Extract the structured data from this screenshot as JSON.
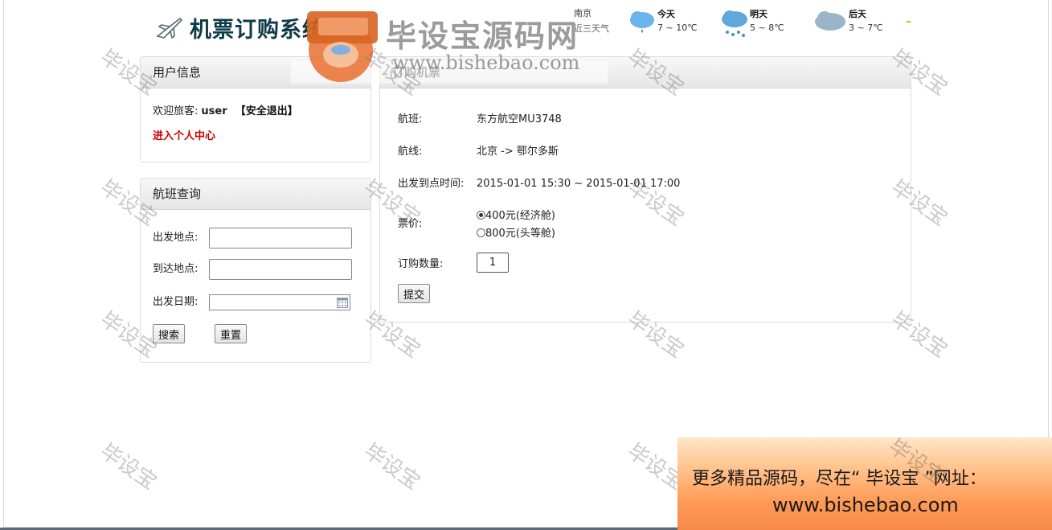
{
  "header": {
    "title": "机票订购系统",
    "plane_icon": "airplane-icon"
  },
  "weather": {
    "city": "南京",
    "subtitle": "近三天气",
    "days": [
      {
        "label": "今天",
        "temp": "7 ~ 10℃",
        "icon": "rain-cloud-icon"
      },
      {
        "label": "明天",
        "temp": "5 ~ 8℃",
        "icon": "heavy-rain-cloud-icon"
      },
      {
        "label": "后天",
        "temp": "3 ~ 7℃",
        "icon": "cloud-icon"
      }
    ]
  },
  "user_panel": {
    "title": "用户信息",
    "welcome_prefix": "欢迎旅客:",
    "username": "user",
    "logout": "【安全退出】",
    "center_link": "进入个人中心"
  },
  "search_panel": {
    "title": "航班查询",
    "from_label": "出发地点:",
    "from_value": "",
    "to_label": "到达地点:",
    "to_value": "",
    "date_label": "出发日期:",
    "date_value": "",
    "search_button": "搜索",
    "reset_button": "重置"
  },
  "order_panel": {
    "title": "订购机票",
    "flight_label": "航班:",
    "flight_value": "东方航空MU3748",
    "route_label": "航线:",
    "route_value": "北京 -> 鄂尔多斯",
    "time_label": "出发到点时间:",
    "time_value": "2015-01-01 15:30 ~ 2015-01-01 17:00",
    "price_label": "票价:",
    "price_options": [
      {
        "label": "400元(经济舱)",
        "selected": true
      },
      {
        "label": "800元(头等舱)",
        "selected": false
      }
    ],
    "qty_label": "订购数量:",
    "qty_value": "1",
    "submit_button": "提交"
  },
  "watermark": {
    "logo_text": "毕设宝源码网",
    "logo_url": "www.bishebao.com",
    "tile_text": "毕设宝"
  },
  "ad": {
    "line1": "更多精品源码，尽在“ 毕设宝 ”网址：",
    "line2": "www.bishebao.com"
  }
}
